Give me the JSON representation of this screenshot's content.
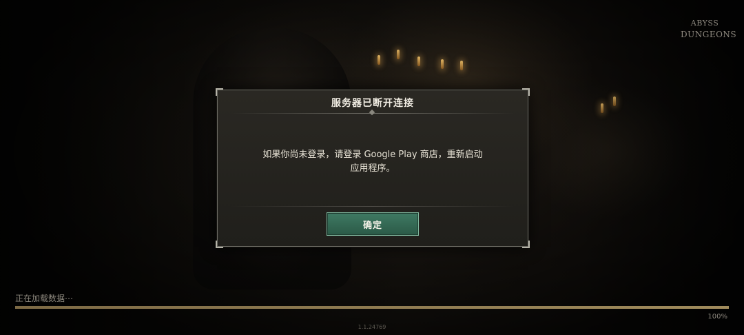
{
  "logo": {
    "line1": "ABYSS",
    "line2": "DUNGEONS"
  },
  "dialog": {
    "title": "服务器已断开连接",
    "message_line1": "如果你尚未登录，请登录 Google Play 商店，重新启动",
    "message_line2": "应用程序。",
    "confirm_label": "确定"
  },
  "loading": {
    "status_text": "正在加载数据⋯",
    "progress_fraction": 1.0,
    "percent_label": "100%"
  },
  "version": "1.1.24769",
  "colors": {
    "confirm_button": "#3a7060",
    "dialog_bg": "#24231f",
    "progress_fill": "#a08b5c"
  }
}
